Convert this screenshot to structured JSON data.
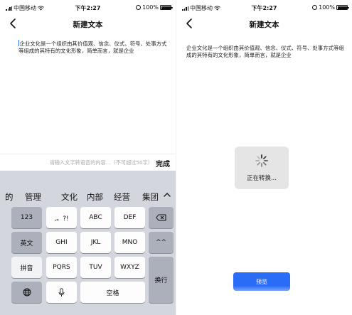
{
  "status": {
    "carrier": "中国移动",
    "time": "下午2:27",
    "battery": "100%"
  },
  "nav": {
    "title": "新建文本"
  },
  "document": {
    "text": "企业文化是一个组织由其价值观、信念、仪式、符号、处事方式等组成的其特有的文化形象，简单而言，就是企业"
  },
  "voice_input": {
    "placeholder": "请输入文字转语音的内容...（不可超过50字）",
    "done_label": "完成"
  },
  "keyboard": {
    "candidates": [
      "的",
      "管理",
      "文化",
      "内部",
      "经营",
      "集团"
    ],
    "rows": {
      "r1": [
        "123",
        ",。?!",
        "ABC",
        "DEF"
      ],
      "r2": [
        "英文",
        "GHI",
        "JKL",
        "MNO",
        "^^"
      ],
      "r3": [
        "拼音",
        "PQRS",
        "TUV",
        "WXYZ"
      ],
      "r4_space": "空格",
      "enter": "换行"
    }
  },
  "converting": {
    "text": "正在转换..."
  },
  "preview_button": "预览",
  "colors": {
    "accent": "#2b6cf6",
    "keyboard_bg": "#d3d6dc",
    "modal_bg": "#e5e5e5"
  }
}
